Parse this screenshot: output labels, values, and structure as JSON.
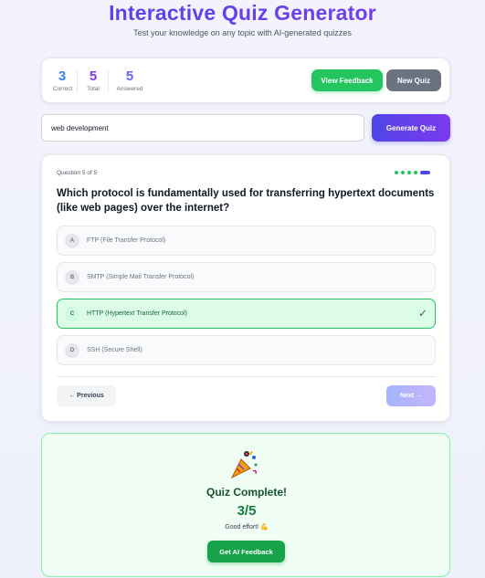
{
  "header": {
    "title": "Interactive Quiz Generator",
    "subtitle": "Test your knowledge on any topic with AI-generated quizzes"
  },
  "stats": {
    "correct_value": "3",
    "correct_label": "Correct",
    "total_value": "5",
    "total_label": "Total",
    "answered_value": "5",
    "answered_label": "Answered",
    "colors": {
      "correct": "#3b82f6",
      "total": "#7c3aed",
      "answered": "#6366f1"
    }
  },
  "toolbar": {
    "view_feedback_label": "View Feedback",
    "new_quiz_label": "New Quiz"
  },
  "topic": {
    "value": "web development",
    "generate_label": "Generate Quiz"
  },
  "quiz": {
    "question_number": "Question 5 of 5",
    "progress": {
      "current": 5,
      "total": 5
    },
    "question": "Which protocol is fundamentally used for transferring hypertext documents (like web pages) over the internet?",
    "options": [
      {
        "letter": "A",
        "text": "FTP (File Transfer Protocol)"
      },
      {
        "letter": "B",
        "text": "SMTP (Simple Mail Transfer Protocol)"
      },
      {
        "letter": "C",
        "text": "HTTP (Hypertext Transfer Protocol)",
        "correct": true
      },
      {
        "letter": "D",
        "text": "SSH (Secure Shell)"
      }
    ],
    "check_icon": "✓",
    "previous_label": "← Previous",
    "next_label": "Next →"
  },
  "result": {
    "icon": "party-popper-icon",
    "title": "Quiz Complete!",
    "score": "3/5",
    "message": "Good effort! 💪",
    "ai_feedback_label": "Get AI Feedback"
  }
}
